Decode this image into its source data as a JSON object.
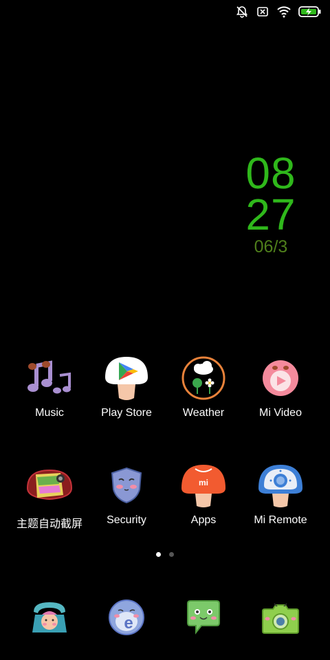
{
  "status_bar": {
    "icons": [
      "notifications-muted-icon",
      "sim-off-icon",
      "wifi-icon",
      "battery-charging-icon"
    ]
  },
  "clock": {
    "hour": "08",
    "minute": "27",
    "date": "06/3"
  },
  "apps": [
    {
      "label": "Music",
      "icon": "music-icon"
    },
    {
      "label": "Play Store",
      "icon": "play-store-icon"
    },
    {
      "label": "Weather",
      "icon": "weather-icon"
    },
    {
      "label": "Mi Video",
      "icon": "video-icon"
    },
    {
      "label": "主题自动截屏",
      "icon": "theme-screenshot-icon"
    },
    {
      "label": "Security",
      "icon": "security-icon"
    },
    {
      "label": "Apps",
      "icon": "apps-icon"
    },
    {
      "label": "Mi Remote",
      "icon": "remote-icon"
    }
  ],
  "pages": {
    "count": 2,
    "active": 1
  },
  "dock": [
    {
      "icon": "phone-icon"
    },
    {
      "icon": "browser-icon"
    },
    {
      "icon": "messages-icon"
    },
    {
      "icon": "camera-icon"
    }
  ]
}
